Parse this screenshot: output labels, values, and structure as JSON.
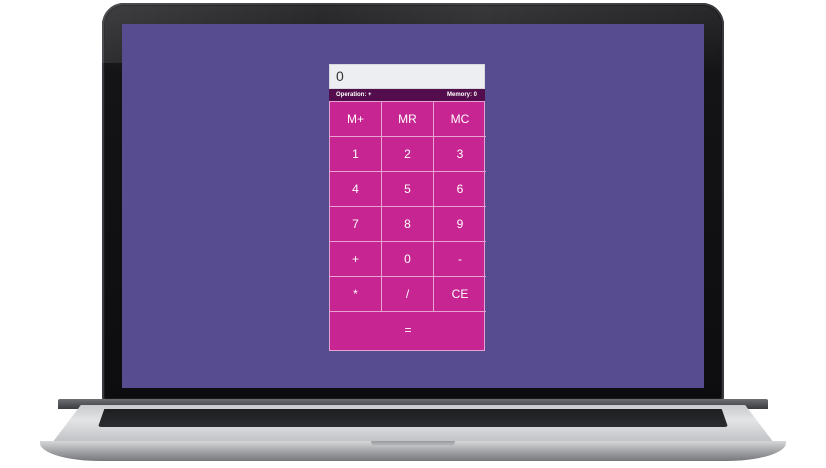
{
  "calculator": {
    "display_value": "0",
    "status": {
      "operation": "Operation: +",
      "memory": "Memory: 0"
    },
    "keys": {
      "m_plus": "M+",
      "mr": "MR",
      "mc": "MC",
      "one": "1",
      "two": "2",
      "three": "3",
      "four": "4",
      "five": "5",
      "six": "6",
      "seven": "7",
      "eight": "8",
      "nine": "9",
      "plus": "+",
      "zero": "0",
      "minus": "-",
      "multiply": "*",
      "divide": "/",
      "clear_entry": "CE",
      "equals": "="
    }
  },
  "colors": {
    "screen_background": "#574c90",
    "keypad": "#c72592",
    "status_bar": "#530d4c",
    "display": "#eceef1"
  }
}
